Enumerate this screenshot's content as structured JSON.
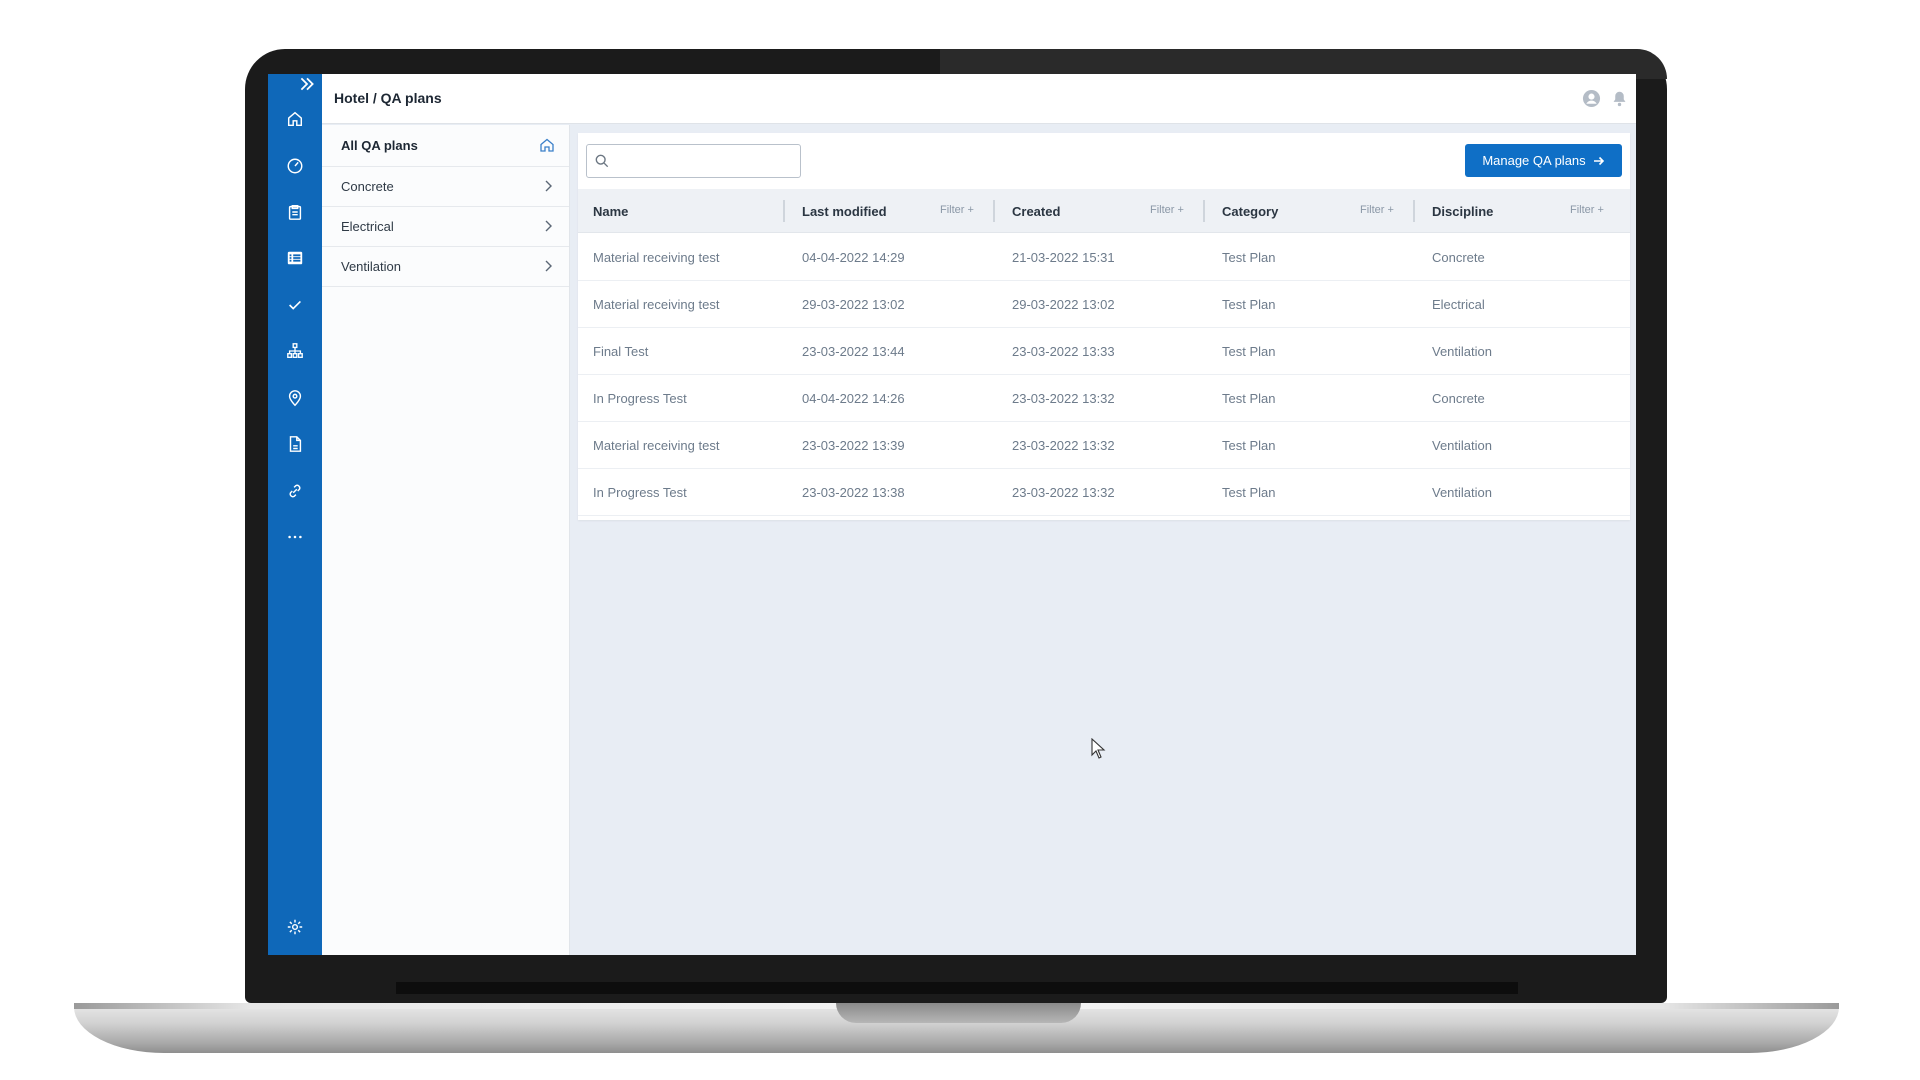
{
  "breadcrumb": "Hotel / QA plans",
  "sidebar": {
    "header": "All QA plans",
    "items": [
      {
        "label": "Concrete"
      },
      {
        "label": "Electrical"
      },
      {
        "label": "Ventilation"
      }
    ]
  },
  "rail": {
    "icons": [
      "expand-icon",
      "home-icon",
      "dashboard-icon",
      "clipboard-icon",
      "list-icon",
      "check-icon",
      "hierarchy-icon",
      "location-icon",
      "document-icon",
      "link-icon",
      "more-icon",
      "settings-icon"
    ]
  },
  "toolbar": {
    "search_placeholder": "",
    "manage_label": "Manage QA plans"
  },
  "table": {
    "filter_label": "Filter +",
    "columns": [
      {
        "label": "Name"
      },
      {
        "label": "Last modified"
      },
      {
        "label": "Created"
      },
      {
        "label": "Category"
      },
      {
        "label": "Discipline"
      }
    ],
    "rows": [
      [
        "Material receiving test",
        "04-04-2022 14:29",
        "21-03-2022 15:31",
        "Test Plan",
        "Concrete"
      ],
      [
        "Material receiving test",
        "29-03-2022 13:02",
        "29-03-2022 13:02",
        "Test Plan",
        "Electrical"
      ],
      [
        "Final Test",
        "23-03-2022 13:44",
        "23-03-2022 13:33",
        "Test Plan",
        "Ventilation"
      ],
      [
        "In Progress Test",
        "04-04-2022 14:26",
        "23-03-2022 13:32",
        "Test Plan",
        "Concrete"
      ],
      [
        "Material receiving test",
        "23-03-2022 13:39",
        "23-03-2022 13:32",
        "Test Plan",
        "Ventilation"
      ],
      [
        "In Progress Test",
        "23-03-2022 13:38",
        "23-03-2022 13:32",
        "Test Plan",
        "Ventilation"
      ]
    ]
  },
  "colors": {
    "brand_blue": "#0f68b9",
    "button_blue": "#0f6fc6",
    "content_bg": "#e8edf4"
  }
}
